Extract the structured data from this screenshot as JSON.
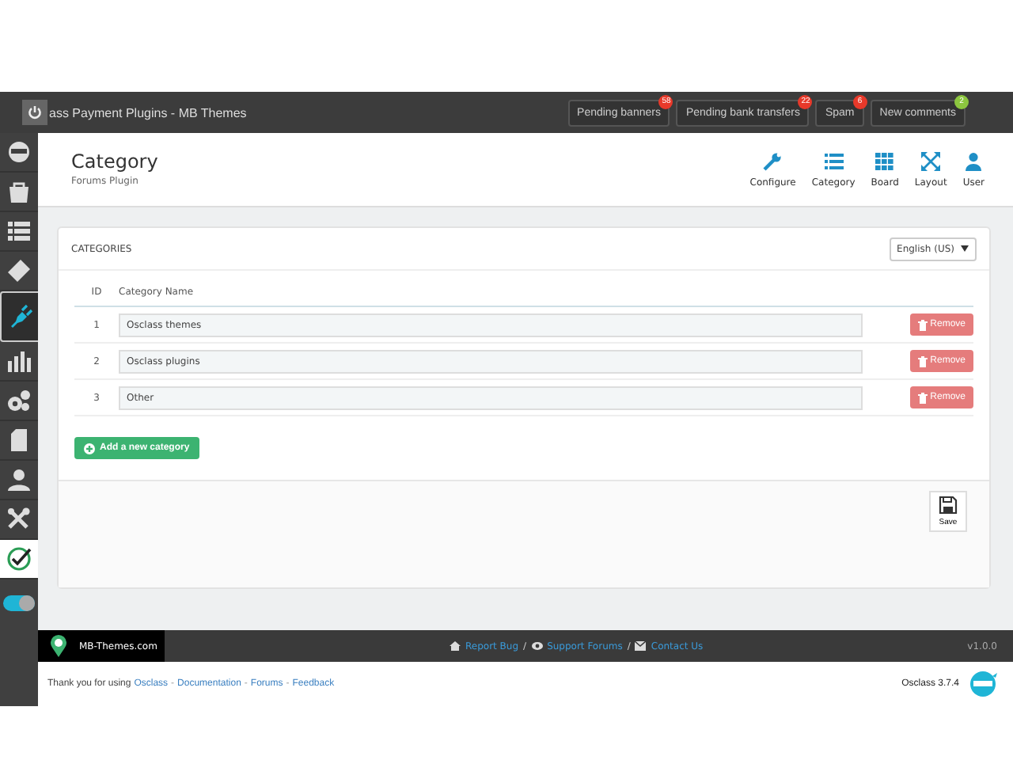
{
  "topbar": {
    "title": "ass Payment Plugins - MB Themes",
    "notices": [
      {
        "label": "Pending banners",
        "count": "58",
        "color": "#e8392a"
      },
      {
        "label": "Pending bank transfers",
        "count": "22",
        "color": "#e8392a"
      },
      {
        "label": "Spam",
        "count": "6",
        "color": "#e8392a"
      },
      {
        "label": "New comments",
        "count": "2",
        "color": "#8cc63f"
      }
    ]
  },
  "sidebar": {
    "items": [
      {
        "kind": "ninja",
        "selected": false
      },
      {
        "kind": "bag",
        "selected": false
      },
      {
        "kind": "list",
        "selected": false
      },
      {
        "kind": "tag",
        "selected": false
      },
      {
        "kind": "plug",
        "selected": true
      },
      {
        "kind": "chart",
        "selected": false
      },
      {
        "kind": "gears",
        "selected": false
      },
      {
        "kind": "page",
        "selected": false
      },
      {
        "kind": "user",
        "selected": false
      },
      {
        "kind": "tools",
        "selected": false
      },
      {
        "kind": "check",
        "selected": false
      }
    ],
    "toggle": {
      "on": true
    }
  },
  "header": {
    "title": "Category",
    "subtitle": "Forums Plugin",
    "nav": [
      {
        "kind": "wrench",
        "label": "Configure"
      },
      {
        "kind": "list",
        "label": "Category"
      },
      {
        "kind": "grid",
        "label": "Board"
      },
      {
        "kind": "expand",
        "label": "Layout"
      },
      {
        "kind": "user",
        "label": "User"
      }
    ]
  },
  "card": {
    "title": "CATEGORIES",
    "language": "English (US)",
    "columns": [
      "ID",
      "Category Name"
    ],
    "rows": [
      {
        "id": "1",
        "name": "Osclass themes",
        "action": "Remove"
      },
      {
        "id": "2",
        "name": "Osclass plugins",
        "action": "Remove"
      },
      {
        "id": "3",
        "name": "Other",
        "action": "Remove"
      }
    ],
    "add_button": "Add a new category",
    "save_button": "Save"
  },
  "footer": {
    "brand": "MB-Themes.com",
    "links": [
      "Report Bug",
      "Support Forums",
      "Contact Us"
    ],
    "separator": "/",
    "version": "v1.0.0"
  },
  "bottom": {
    "text": "Thank you for using",
    "separator": "-",
    "links": [
      "Osclass",
      "Documentation",
      "Forums",
      "Feedback"
    ],
    "version": "Osclass 3.7.4"
  }
}
